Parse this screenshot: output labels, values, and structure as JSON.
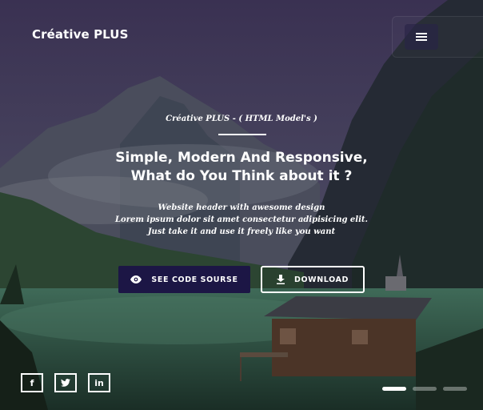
{
  "brand": "Créative PLUS",
  "menu": {
    "icon": "hamburger-menu-icon"
  },
  "hero": {
    "kicker": "Créative PLUS - ( HTML Model's )",
    "headline_line1": "Simple, Modern And Responsive,",
    "headline_line2": "What do You Think about it ?",
    "sub_line1": "Website header with awesome design",
    "sub_line2": "Lorem ipsum dolor sit amet consectetur adipisicing elit.",
    "sub_line3": "Just take it and use it freely like you want"
  },
  "buttons": {
    "code_label": "SEE CODE SOURSE",
    "code_icon": "eye-icon",
    "download_label": "DOWNLOAD",
    "download_icon": "download-icon"
  },
  "social": [
    {
      "name": "facebook",
      "glyph": "f"
    },
    {
      "name": "twitter",
      "glyph": "t"
    },
    {
      "name": "linkedin",
      "glyph": "in"
    }
  ],
  "slider": {
    "slides": 3,
    "active": 1
  },
  "colors": {
    "code_button_bg": "#1c1645",
    "text": "#ffffff"
  }
}
